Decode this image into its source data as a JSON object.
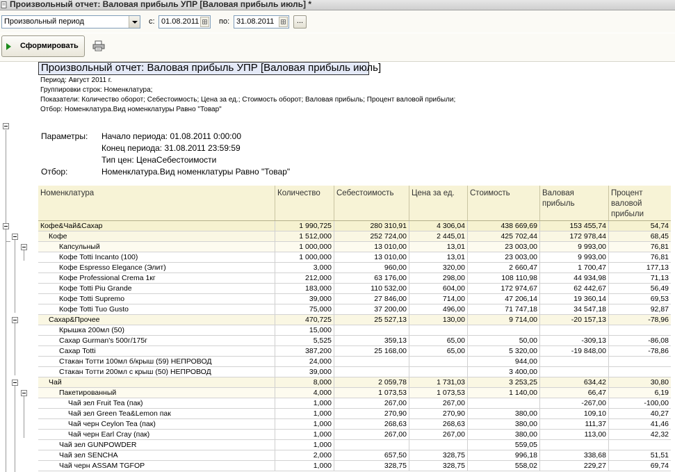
{
  "window": {
    "title": "Произвольный отчет: Валовая прибыль УПР [Валовая прибыль июль] *"
  },
  "toolbar": {
    "period_type": "Произвольный период",
    "from_label": "с:",
    "from_date": "01.08.2011",
    "to_label": "по:",
    "to_date": "31.08.2011",
    "more_label": "...",
    "generate_label": "Сформировать"
  },
  "report": {
    "title": "Произвольный отчет: Валовая прибыль УПР [Валовая прибыль июль]",
    "meta": [
      "Период: Август 2011 г.",
      "Группировки строк: Номенклатура;",
      "Показатели: Количество оборот; Себестоимость; Цена за ед.; Стоимость оборот; Валовая прибыль; Процент валовой прибыли;",
      "Отбор: Номенклатура.Вид номенклатуры Равно \"Товар\""
    ],
    "params_label": "Параметры:",
    "params": [
      "Начало периода: 01.08.2011 0:00:00",
      "Конец периода: 31.08.2011 23:59:59",
      "Тип цен: ЦенаСебестоимости"
    ],
    "filter_label": "Отбор:",
    "filter_value": "Номенклатура.Вид номенклатуры Равно \"Товар\""
  },
  "table": {
    "columns": [
      "Номенклатура",
      "Количество",
      "Себестоимость",
      "Цена за ед.",
      "Стоимость",
      "Валовая прибыль",
      "Процент валовой прибыли"
    ],
    "rows": [
      {
        "level": 0,
        "name": "Кофе&Чай&Сахар",
        "qty": "1 990,725",
        "cost": "280 310,91",
        "price": "4 306,04",
        "value": "438 669,69",
        "profit": "153 455,74",
        "pct": "54,74"
      },
      {
        "level": 1,
        "name": "Кофе",
        "qty": "1 512,000",
        "cost": "252 724,00",
        "price": "2 445,01",
        "value": "425 702,44",
        "profit": "172 978,44",
        "pct": "68,45"
      },
      {
        "level": 2,
        "name": "Капсульный",
        "qty": "1 000,000",
        "cost": "13 010,00",
        "price": "13,01",
        "value": "23 003,00",
        "profit": "9 993,00",
        "pct": "76,81"
      },
      {
        "level": 3,
        "name": "Кофе Totti Incanto (100)",
        "qty": "1 000,000",
        "cost": "13 010,00",
        "price": "13,01",
        "value": "23 003,00",
        "profit": "9 993,00",
        "pct": "76,81"
      },
      {
        "level": 3,
        "name": "Кофе Espresso Elegance (Элит)",
        "qty": "3,000",
        "cost": "960,00",
        "price": "320,00",
        "value": "2 660,47",
        "profit": "1 700,47",
        "pct": "177,13"
      },
      {
        "level": 3,
        "name": "Кофе Professional Crema 1кг",
        "qty": "212,000",
        "cost": "63 176,00",
        "price": "298,00",
        "value": "108 110,98",
        "profit": "44 934,98",
        "pct": "71,13"
      },
      {
        "level": 3,
        "name": "Кофе Totti  Piu Grande",
        "qty": "183,000",
        "cost": "110 532,00",
        "price": "604,00",
        "value": "172 974,67",
        "profit": "62 442,67",
        "pct": "56,49"
      },
      {
        "level": 3,
        "name": "Кофе Totti  Supremo",
        "qty": "39,000",
        "cost": "27 846,00",
        "price": "714,00",
        "value": "47 206,14",
        "profit": "19 360,14",
        "pct": "69,53"
      },
      {
        "level": 3,
        "name": "Кофе Totti Tuo  Gusto",
        "qty": "75,000",
        "cost": "37 200,00",
        "price": "496,00",
        "value": "71 747,18",
        "profit": "34 547,18",
        "pct": "92,87"
      },
      {
        "level": 1,
        "name": "Сахар&Прочее",
        "qty": "470,725",
        "cost": "25 527,13",
        "price": "130,00",
        "value": "9 714,00",
        "profit": "-20 157,13",
        "pct": "-78,96"
      },
      {
        "level": 3,
        "name": "Крышка 200мл (50)",
        "qty": "15,000",
        "cost": "",
        "price": "",
        "value": "",
        "profit": "",
        "pct": ""
      },
      {
        "level": 3,
        "name": "Сахар Gurman's 500г/175г",
        "qty": "5,525",
        "cost": "359,13",
        "price": "65,00",
        "value": "50,00",
        "profit": "-309,13",
        "pct": "-86,08"
      },
      {
        "level": 3,
        "name": "Сахар Totti",
        "qty": "387,200",
        "cost": "25 168,00",
        "price": "65,00",
        "value": "5 320,00",
        "profit": "-19 848,00",
        "pct": "-78,86"
      },
      {
        "level": 3,
        "name": "Стакан Тотти 100мл б/крыш (59)  НЕПРОВОД",
        "qty": "24,000",
        "cost": "",
        "price": "",
        "value": "944,00",
        "profit": "",
        "pct": ""
      },
      {
        "level": 3,
        "name": "Стакан Тотти 200мл с крыш (50)  НЕПРОВОД",
        "qty": "39,000",
        "cost": "",
        "price": "",
        "value": "3 400,00",
        "profit": "",
        "pct": ""
      },
      {
        "level": 1,
        "name": "Чай",
        "qty": "8,000",
        "cost": "2 059,78",
        "price": "1 731,03",
        "value": "3 253,25",
        "profit": "634,42",
        "pct": "30,80"
      },
      {
        "level": 2,
        "name": "Пакетированный",
        "qty": "4,000",
        "cost": "1 073,53",
        "price": "1 073,53",
        "value": "1 140,00",
        "profit": "66,47",
        "pct": "6,19"
      },
      {
        "level": 4,
        "name": "Чай зел Fruit Tea (пак)",
        "qty": "1,000",
        "cost": "267,00",
        "price": "267,00",
        "value": "",
        "profit": "-267,00",
        "pct": "-100,00"
      },
      {
        "level": 4,
        "name": "Чай зел Green Tea&Lemon пак",
        "qty": "1,000",
        "cost": "270,90",
        "price": "270,90",
        "value": "380,00",
        "profit": "109,10",
        "pct": "40,27"
      },
      {
        "level": 4,
        "name": "Чай черн Ceylon Tea (пак)",
        "qty": "1,000",
        "cost": "268,63",
        "price": "268,63",
        "value": "380,00",
        "profit": "111,37",
        "pct": "41,46"
      },
      {
        "level": 4,
        "name": "Чай черн Earl Cray (пак)",
        "qty": "1,000",
        "cost": "267,00",
        "price": "267,00",
        "value": "380,00",
        "profit": "113,00",
        "pct": "42,32"
      },
      {
        "level": 3,
        "name": "Чай зел GUNPOWDER",
        "qty": "1,000",
        "cost": "",
        "price": "",
        "value": "559,05",
        "profit": "",
        "pct": ""
      },
      {
        "level": 3,
        "name": "Чай зел SENCHA",
        "qty": "2,000",
        "cost": "657,50",
        "price": "328,75",
        "value": "996,18",
        "profit": "338,68",
        "pct": "51,51"
      },
      {
        "level": 3,
        "name": "Чай черн  ASSAM TGFOP",
        "qty": "1,000",
        "cost": "328,75",
        "price": "328,75",
        "value": "558,02",
        "profit": "229,27",
        "pct": "69,74"
      }
    ]
  }
}
